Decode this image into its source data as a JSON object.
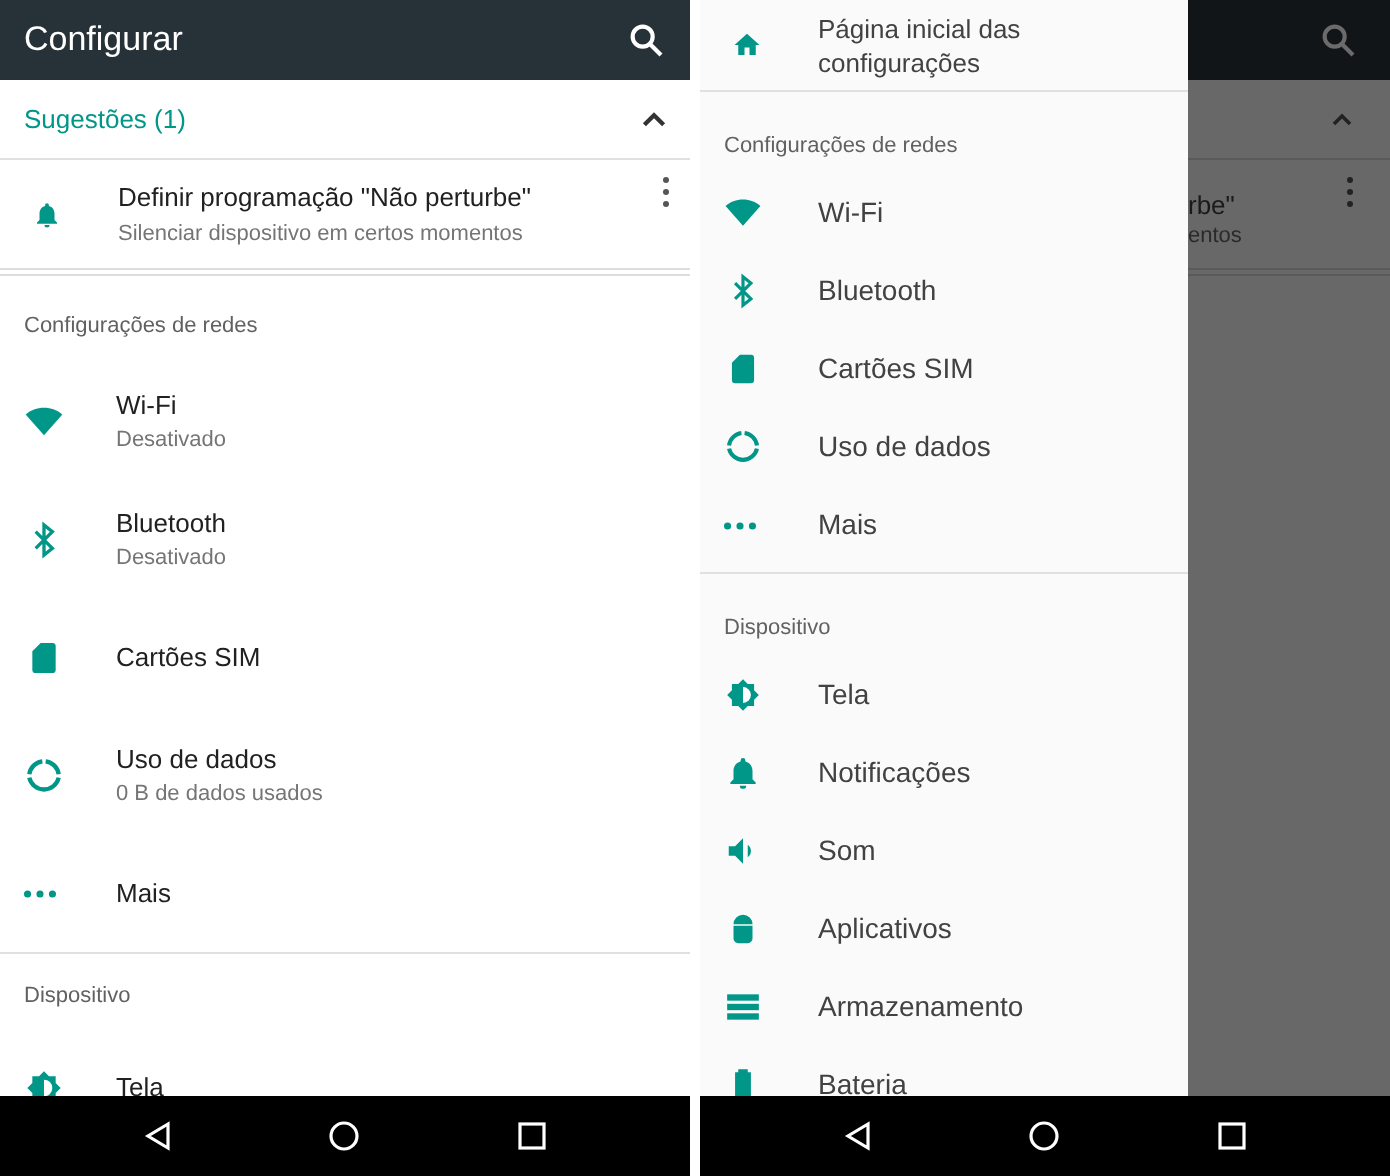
{
  "left_screen": {
    "app_bar": {
      "title": "Configurar"
    },
    "suggestions": {
      "header": "Sugestões (1)",
      "expanded": true,
      "items": [
        {
          "title": "Definir programação \"Não perturbe\"",
          "subtitle": "Silenciar dispositivo em certos momentos",
          "kind": "bell"
        }
      ]
    },
    "sections": [
      {
        "title": "Configurações de redes",
        "items": [
          {
            "kind": "wifi",
            "title": "Wi-Fi",
            "subtitle": "Desativado"
          },
          {
            "kind": "bluetooth",
            "title": "Bluetooth",
            "subtitle": "Desativado"
          },
          {
            "kind": "sim",
            "title": "Cartões SIM"
          },
          {
            "kind": "data",
            "title": "Uso de dados",
            "subtitle": "0 B de dados usados"
          },
          {
            "kind": "more",
            "title": "Mais"
          }
        ]
      },
      {
        "title": "Dispositivo",
        "items": [
          {
            "kind": "brightness",
            "title": "Tela"
          }
        ]
      }
    ]
  },
  "right_screen": {
    "drawer": {
      "home": {
        "kind": "home",
        "title": "Página inicial das configurações"
      },
      "sections": [
        {
          "title": "Configurações de redes",
          "items": [
            {
              "kind": "wifi",
              "title": "Wi-Fi"
            },
            {
              "kind": "bluetooth",
              "title": "Bluetooth"
            },
            {
              "kind": "sim",
              "title": "Cartões SIM"
            },
            {
              "kind": "data",
              "title": "Uso de dados"
            },
            {
              "kind": "more",
              "title": "Mais"
            }
          ]
        },
        {
          "title": "Dispositivo",
          "items": [
            {
              "kind": "brightness",
              "title": "Tela"
            },
            {
              "kind": "bell",
              "title": "Notificações"
            },
            {
              "kind": "volume",
              "title": "Som"
            },
            {
              "kind": "android",
              "title": "Aplicativos"
            },
            {
              "kind": "storage",
              "title": "Armazenamento"
            },
            {
              "kind": "battery",
              "title": "Bateria"
            }
          ]
        }
      ]
    },
    "dimmed_background": {
      "suggestion_title": "rbe\"",
      "suggestion_subtitle": "entos"
    }
  }
}
